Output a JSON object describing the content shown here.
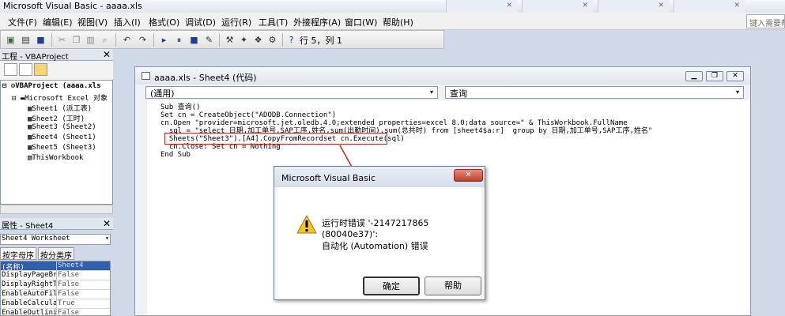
{
  "app": {
    "title": "Microsoft Visual Basic - aaaa.xls",
    "help_search_placeholder": "键入需要帮"
  },
  "menu": [
    "文件(F)",
    "编辑(E)",
    "视图(V)",
    "插入(I)",
    "格式(O)",
    "调试(D)",
    "运行(R)",
    "工具(T)",
    "外接程序(A)",
    "窗口(W)",
    "帮助(H)"
  ],
  "toolbar": {
    "position": "行 5，列 1"
  },
  "project": {
    "header": "工程 - VBAProject",
    "tree": [
      "VBAProject (aaaa.xls",
      "Microsoft Excel 对象",
      "Sheet1 (派工表)",
      "Sheet2 (工时)",
      "Sheet3 (Sheet2)",
      "Sheet4 (Sheet1)",
      "Sheet5 (Sheet3)",
      "ThisWorkbook"
    ]
  },
  "properties": {
    "header": "属性 - Sheet4",
    "object": "Sheet4 Worksheet",
    "tabs": [
      "按字母序",
      "按分类序"
    ],
    "rows": [
      {
        "name": "(名称)",
        "value": "Sheet4"
      },
      {
        "name": "DisplayPageBre",
        "value": "False"
      },
      {
        "name": "DisplayRightTo",
        "value": "False"
      },
      {
        "name": "EnableAutoFilt",
        "value": "False"
      },
      {
        "name": "EnableCalculat",
        "value": "True"
      },
      {
        "name": "EnableOutlinin",
        "value": "False"
      }
    ]
  },
  "codewindow": {
    "title": "aaaa.xls - Sheet4 (代码)",
    "object_combo": "(通用)",
    "proc_combo": "查询",
    "lines": [
      "Sub 查询()",
      "Set cn = CreateObject(\"ADODB.Connection\")",
      "cn.Open \"provider=microsoft.jet.oledb.4.0;extended properties=excel 8.0;data source=\" & ThisWorkbook.FullName",
      "  sql = \"select 日期,加工单号,SAP工序,姓名,sum(出勤时间),sum(总共时) from [sheet4$a:r]  group by 日期,加工单号,SAP工序,姓名\"",
      "  Sheets(\"Sheet3\").[A4].CopyFromRecordset cn.Execute(sql)",
      "  cn.Close: Set cn = Nothing",
      "End Sub"
    ]
  },
  "dialog": {
    "title": "Microsoft Visual Basic",
    "close_glyph": "✕",
    "message1": "运行时错误 '-2147217865 (80040e37)':",
    "message2": "自动化 (Automation) 错误",
    "ok": "确定",
    "help": "帮助"
  },
  "colors": {
    "highlight_border": "#cc2222",
    "close_button": "#c23d2b"
  }
}
